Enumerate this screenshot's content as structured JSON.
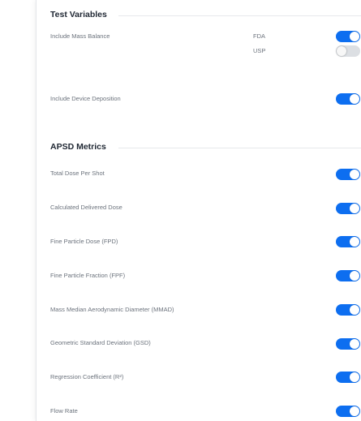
{
  "test_variables": {
    "title": "Test Variables",
    "mass_balance": {
      "label": "Include Mass Balance",
      "fda_label": "FDA",
      "fda_on": true,
      "usp_label": "USP",
      "usp_on": false
    },
    "device_deposition": {
      "label": "Include Device Deposition",
      "on": true
    }
  },
  "apsd_metrics": {
    "title": "APSD Metrics",
    "items": [
      {
        "label": "Total Dose Per Shot",
        "on": true
      },
      {
        "label": "Calculated Delivered Dose",
        "on": true
      },
      {
        "label": "Fine Particle Dose (FPD)",
        "on": true
      },
      {
        "label": "Fine Particle Fraction (FPF)",
        "on": true
      },
      {
        "label": "Mass Median Aerodynamic Diameter (MMAD)",
        "on": true
      },
      {
        "label": "Geometric Standard Deviation (GSD)",
        "on": true
      },
      {
        "label": "Regression Coefficient (R²)",
        "on": true
      },
      {
        "label": "Flow Rate",
        "on": true
      }
    ]
  },
  "colors": {
    "toggle_on": "#0d6ef0",
    "toggle_off": "#dcdfe3",
    "label_text": "#6b727c",
    "heading_text": "#1f2733"
  }
}
